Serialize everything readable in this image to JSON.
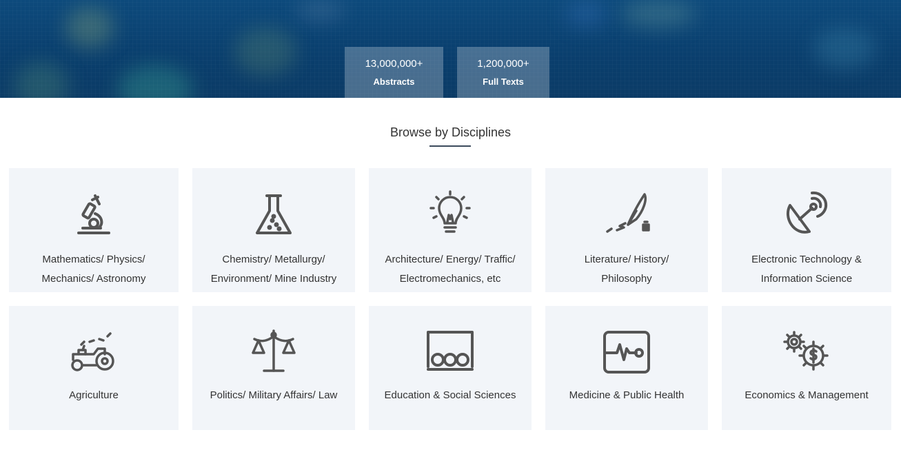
{
  "stats": [
    {
      "number": "13,000,000+",
      "label": "Abstracts"
    },
    {
      "number": "1,200,000+",
      "label": "Full Texts"
    }
  ],
  "section_title": "Browse by Disciplines",
  "disciplines": [
    {
      "line1": "Mathematics/ Physics/",
      "line2": "Mechanics/ Astronomy",
      "icon": "microscope-icon"
    },
    {
      "line1": "Chemistry/ Metallurgy/",
      "line2": "Environment/ Mine Industry",
      "icon": "flask-icon"
    },
    {
      "line1": "Architecture/ Energy/ Traffic/",
      "line2": "Electromechanics, etc",
      "icon": "lightbulb-icon"
    },
    {
      "line1": "Literature/ History/",
      "line2": "Philosophy",
      "icon": "quill-pen-icon"
    },
    {
      "line1": "Electronic Technology &",
      "line2": "Information Science",
      "icon": "satellite-dish-icon"
    },
    {
      "line1": "Agriculture",
      "icon": "tractor-icon"
    },
    {
      "line1": "Politics/ Military Affairs/ Law",
      "icon": "scales-icon"
    },
    {
      "line1": "Education & Social Sciences",
      "icon": "classroom-icon"
    },
    {
      "line1": "Medicine & Public Health",
      "icon": "heartbeat-monitor-icon"
    },
    {
      "line1": "Economics & Management",
      "icon": "gears-dollar-icon"
    }
  ],
  "colors": {
    "hero": "#0b4274",
    "card_bg": "#f2f5f9",
    "icon": "#555555",
    "text": "#333333"
  }
}
